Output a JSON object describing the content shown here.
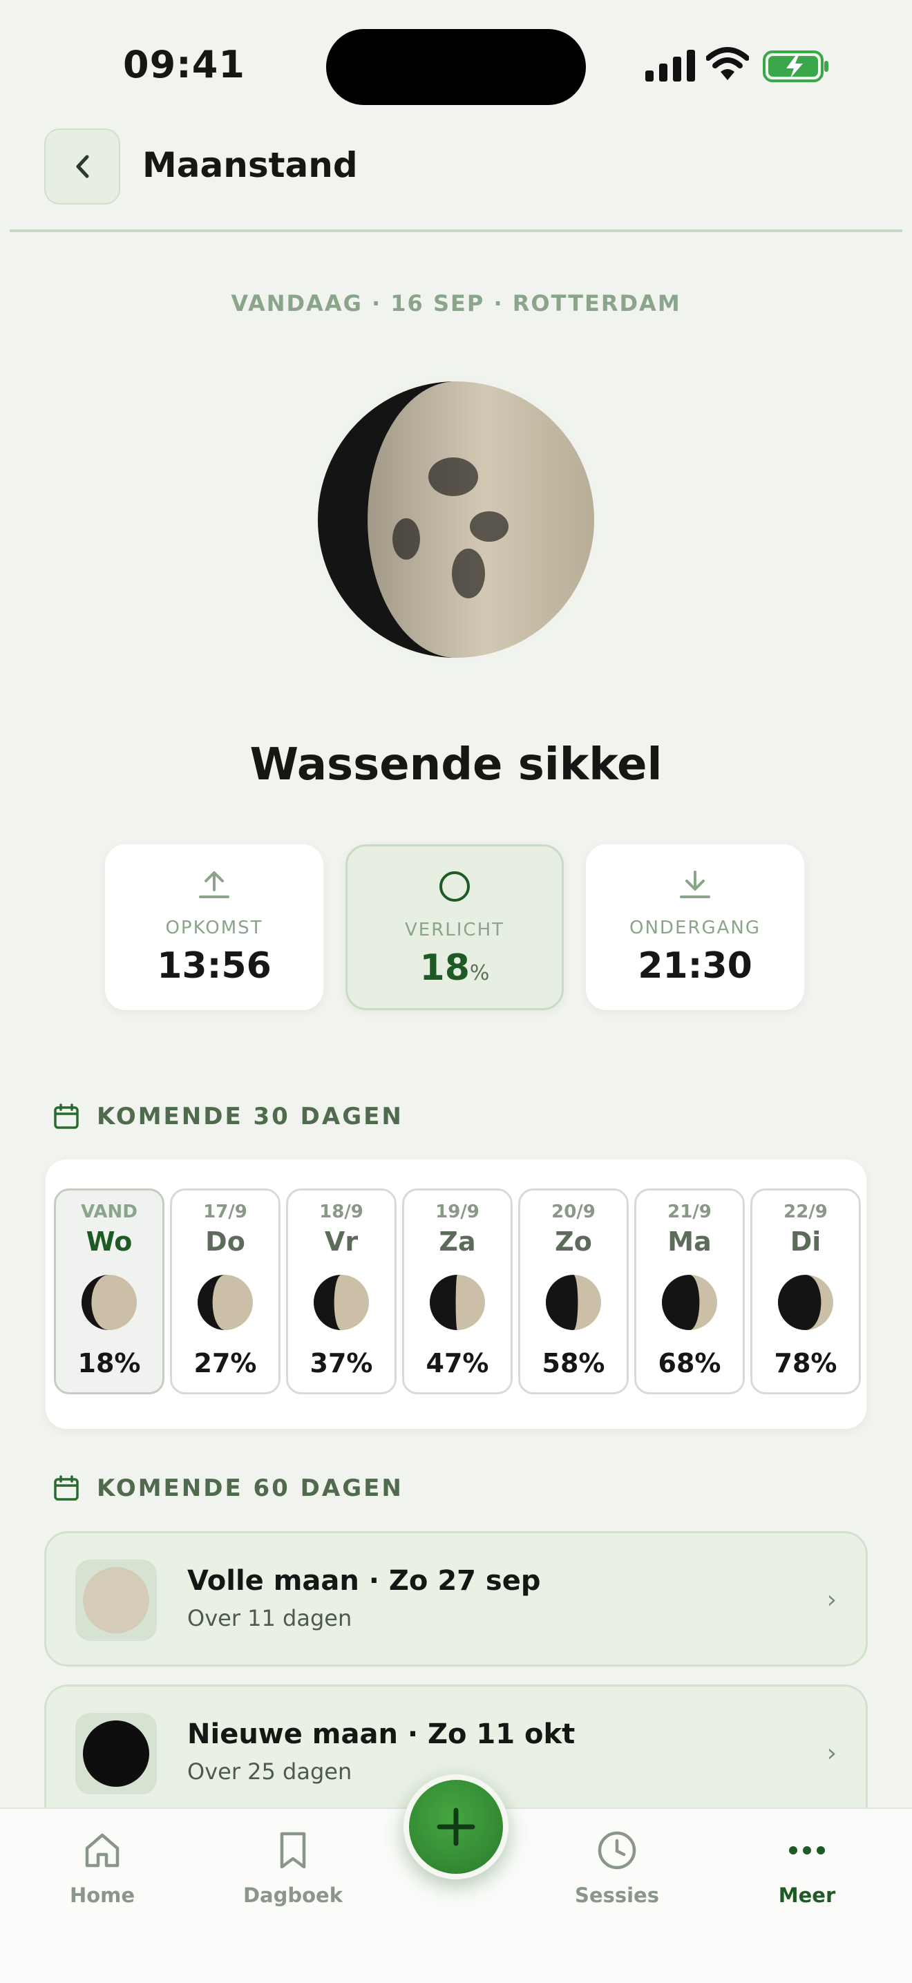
{
  "status_bar": {
    "time": "09:41"
  },
  "header": {
    "title": "Maanstand"
  },
  "today_line": "VANDAAG · 16 SEP · ROTTERDAM",
  "phase": {
    "name": "Wassende sikkel",
    "illumination": 0.18
  },
  "stats": {
    "rise": {
      "label": "OPKOMST",
      "value": "13:56",
      "icon": "arrow-up-icon"
    },
    "lit": {
      "label": "VERLICHT",
      "value": "18",
      "unit": "%",
      "icon": "circle-icon"
    },
    "set": {
      "label": "ONDERGANG",
      "value": "21:30",
      "icon": "arrow-down-icon"
    }
  },
  "next30": {
    "heading": "KOMENDE 30 DAGEN",
    "days": [
      {
        "date": "VAND",
        "day": "Wo",
        "pct": "18%",
        "illumination": 0.18
      },
      {
        "date": "17/9",
        "day": "Do",
        "pct": "27%",
        "illumination": 0.27
      },
      {
        "date": "18/9",
        "day": "Vr",
        "pct": "37%",
        "illumination": 0.37
      },
      {
        "date": "19/9",
        "day": "Za",
        "pct": "47%",
        "illumination": 0.47
      },
      {
        "date": "20/9",
        "day": "Zo",
        "pct": "58%",
        "illumination": 0.58
      },
      {
        "date": "21/9",
        "day": "Ma",
        "pct": "68%",
        "illumination": 0.68
      },
      {
        "date": "22/9",
        "day": "Di",
        "pct": "78%",
        "illumination": 0.78
      }
    ]
  },
  "next60": {
    "heading": "KOMENDE 60 DAGEN",
    "events": [
      {
        "title": "Volle maan · Zo 27 sep",
        "subtitle": "Over 11 dagen",
        "chevron": "›"
      },
      {
        "title": "Nieuwe maan · Zo 11 okt",
        "subtitle": "Over 25 dagen",
        "chevron": "›"
      }
    ]
  },
  "nav": {
    "home": "Home",
    "diary": "Dagboek",
    "sessions": "Sessies",
    "more": "Meer",
    "active": "more"
  },
  "colors": {
    "accent": "#1e5a26",
    "fab": "#3a9a3a",
    "moon_dark": "#141414",
    "moon_lit": "#cbbfa8",
    "background": "#f1f4ee"
  }
}
